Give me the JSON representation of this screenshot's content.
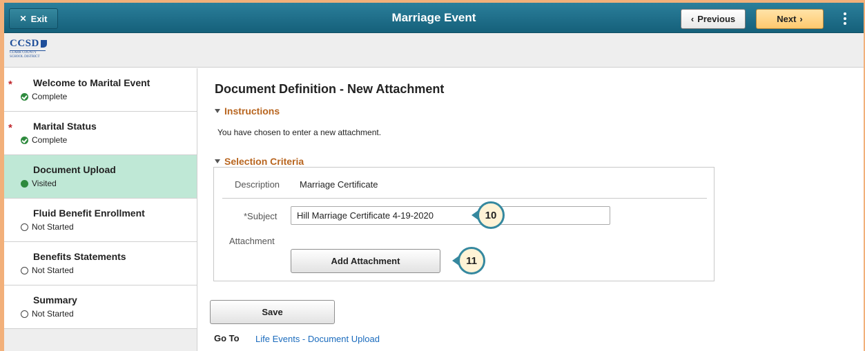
{
  "banner": {
    "exit_label": "Exit",
    "title": "Marriage Event",
    "previous_label": "Previous",
    "next_label": "Next"
  },
  "logo": {
    "name": "CCSD",
    "subtext": "CLARK COUNTY SCHOOL DISTRICT"
  },
  "sidebar": {
    "steps": [
      {
        "label": "Welcome to Marital Event",
        "status": "Complete",
        "required": "*"
      },
      {
        "label": "Marital Status",
        "status": "Complete",
        "required": "*"
      },
      {
        "label": "Document Upload",
        "status": "Visited",
        "required": ""
      },
      {
        "label": "Fluid Benefit Enrollment",
        "status": "Not Started",
        "required": ""
      },
      {
        "label": "Benefits Statements",
        "status": "Not Started",
        "required": ""
      },
      {
        "label": "Summary",
        "status": "Not Started",
        "required": ""
      }
    ],
    "active_index": 2
  },
  "main": {
    "page_title": "Document Definition - New Attachment",
    "instructions_header": "Instructions",
    "instructions_text": "You have chosen to enter a new attachment.",
    "criteria_header": "Selection Criteria",
    "description_label": "Description",
    "description_value": "Marriage Certificate",
    "subject_label": "*Subject",
    "subject_value": "Hill Marriage Certificate 4-19-2020",
    "attachment_label": "Attachment",
    "add_attachment_label": "Add Attachment",
    "save_label": "Save",
    "goto_label": "Go To",
    "goto_link": "Life Events - Document Upload"
  },
  "callouts": [
    "10",
    "11"
  ],
  "colors": {
    "banner": "#1f6f8b",
    "next_button": "#ffc96e",
    "active_step": "#bfe8d6",
    "section_header": "#b8651f",
    "link": "#1a6bbd",
    "required": "#c0262b"
  }
}
